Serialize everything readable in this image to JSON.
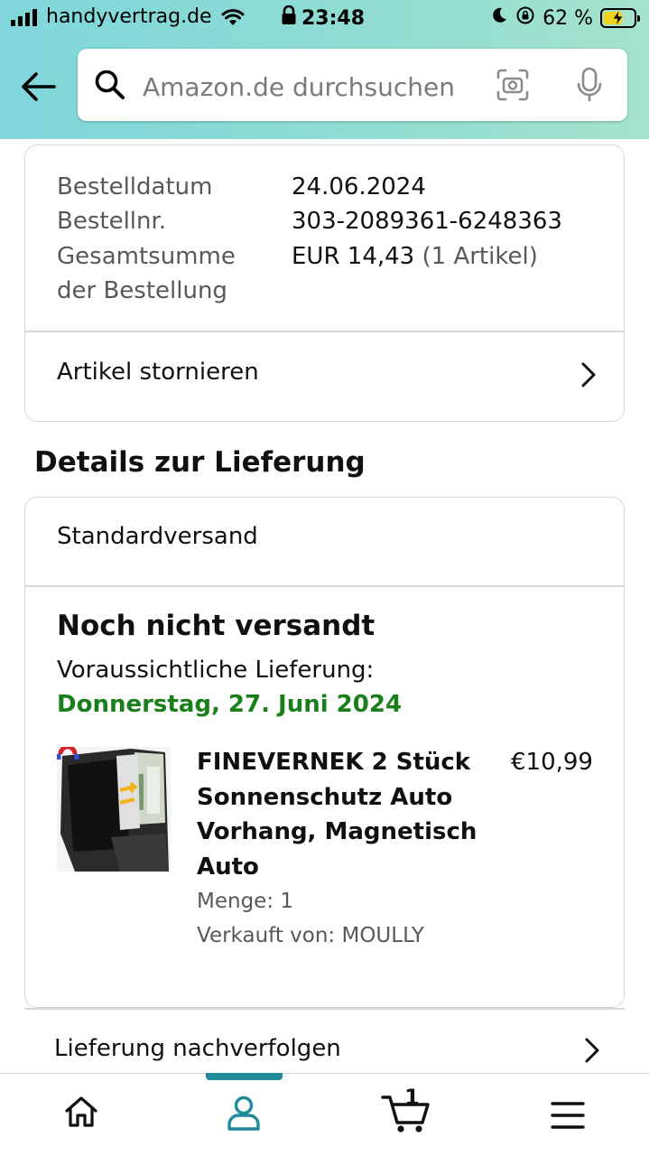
{
  "status_bar": {
    "carrier": "handyvertrag.de",
    "time": "23:48",
    "battery": "62 %",
    "battery_level": 0.62
  },
  "search": {
    "placeholder": "Amazon.de durchsuchen"
  },
  "order_summary": {
    "rows": [
      {
        "label": "Bestelldatum",
        "value": "24.06.2024"
      },
      {
        "label": "Bestellnr.",
        "value": "303-2089361-6248363"
      },
      {
        "label_line1": "Gesamtsumme",
        "label_line2": "der Bestellung",
        "value": "EUR 14,43",
        "value_extra": "(1 Artikel)"
      }
    ],
    "cancel_label": "Artikel stornieren"
  },
  "delivery": {
    "section_title": "Details zur Lieferung",
    "method": "Standardversand",
    "status": "Noch nicht versandt",
    "eta_label": "Voraussichtliche Lieferung:",
    "eta_date": "Donnerstag, 27. Juni 2024",
    "eta_color": "#1a7f1a",
    "product": {
      "name": "FINEVERNEK 2 Stück Sonnenschutz Auto Vorhang, Magnetisch Auto",
      "price": "€10,99",
      "quantity": "Menge: 1",
      "seller": "Verkauft von: MOULLY"
    },
    "track_label": "Lieferung nachverfolgen"
  },
  "bottom_nav": {
    "items": [
      "home-icon",
      "account-icon",
      "cart-icon",
      "menu-icon"
    ],
    "active": "account-icon",
    "cart_count": "1",
    "accent": "#1f8a99"
  }
}
